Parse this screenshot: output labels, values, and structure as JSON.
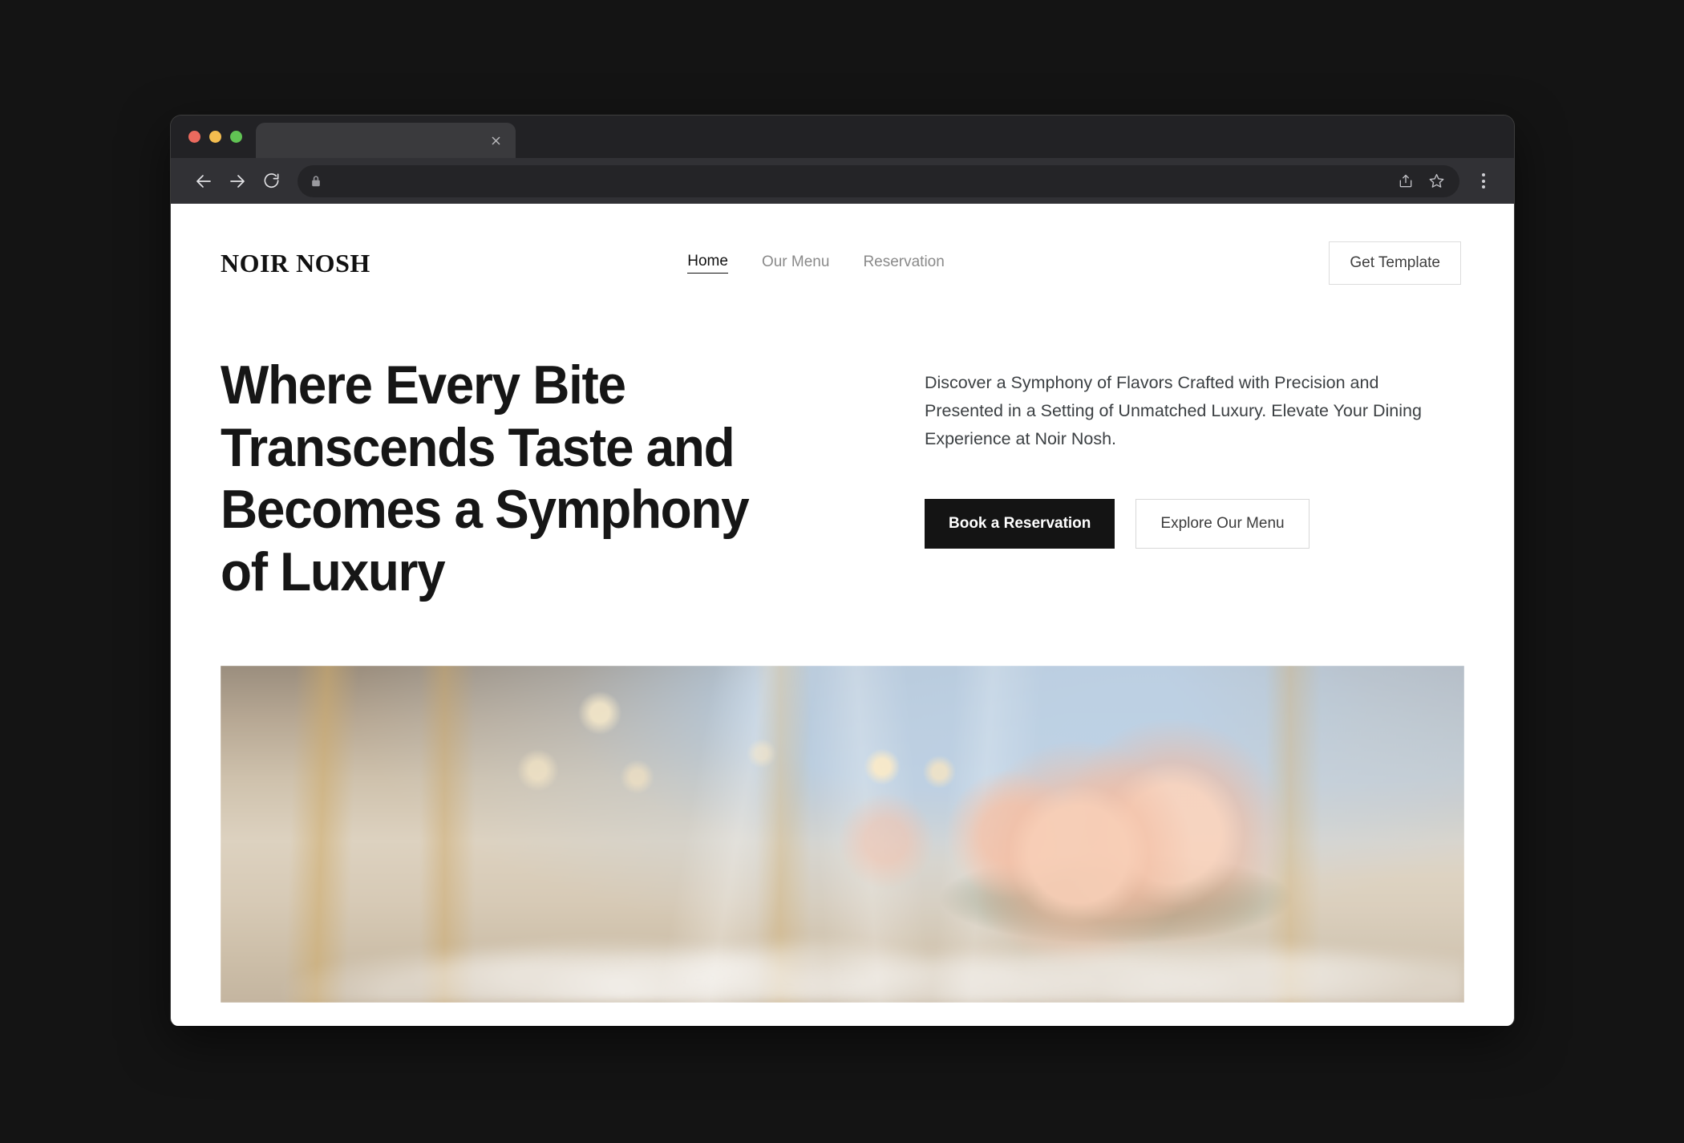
{
  "browser": {
    "tab": {
      "title": "",
      "close_icon": "close-icon"
    },
    "toolbar": {
      "back_icon": "back-arrow-icon",
      "forward_icon": "forward-arrow-icon",
      "reload_icon": "reload-icon",
      "lock_icon": "lock-icon",
      "url": "",
      "url_placeholder": "",
      "share_icon": "share-icon",
      "bookmark_icon": "star-icon",
      "menu_icon": "three-dot-menu-icon"
    },
    "traffic_lights": {
      "close": "#eb6a5e",
      "minimize": "#f4bd4f",
      "maximize": "#61c454"
    }
  },
  "site": {
    "logo": "NOIR NOSH",
    "nav": [
      {
        "label": "Home",
        "active": true
      },
      {
        "label": "Our Menu",
        "active": false
      },
      {
        "label": "Reservation",
        "active": false
      }
    ],
    "header_cta": "Get Template",
    "hero": {
      "title": "Where Every Bite Transcends Taste and Becomes a Symphony of Luxury",
      "subtitle": "Discover a Symphony of Flavors Crafted with Precision and Presented in a Setting of Unmatched Luxury. Elevate Your Dining Experience at Noir Nosh.",
      "primary_cta": "Book a Reservation",
      "secondary_cta": "Explore Our Menu",
      "image_alt": "Blurred elegant restaurant interior with gold cross-back chairs, set tables, wine glasses and blush roses"
    },
    "colors": {
      "ink": "#141414",
      "body_text": "#3c4043",
      "muted_nav": "#8a8a8a",
      "border": "#d8d8d8",
      "page_bg": "#ffffff"
    }
  }
}
